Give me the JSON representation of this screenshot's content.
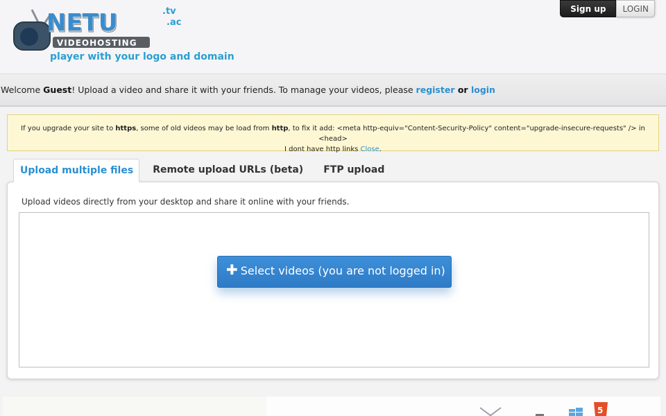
{
  "header": {
    "logo_text": "NETU",
    "logo_sub": "VIDEOHOSTING",
    "domain_tv": ".tv",
    "domain_ac": ".ac",
    "tagline": "player with your logo and domain",
    "signup_label": "Sign up",
    "login_label": "LOGIN"
  },
  "welcome": {
    "prefix": "Welcome ",
    "user": "Guest",
    "text": "! Upload a video and share it with your friends. To manage your videos, please ",
    "register_label": "register",
    "or": " or ",
    "login_label": "login"
  },
  "notice": {
    "p1": "If you upgrade your site to ",
    "https": "https",
    "p2": ", some of old videos may be load from ",
    "http": "http",
    "p3": ", to fix it add: <meta http-equiv=\"Content-Security-Policy\" content=\"upgrade-insecure-requests\" /> in <head>",
    "line2": "I dont have http links ",
    "close_label": "Close",
    "close_suffix": "."
  },
  "tabs": [
    {
      "label": "Upload multiple files",
      "active": true
    },
    {
      "label": "Remote upload URLs (beta)",
      "active": false
    },
    {
      "label": "FTP upload",
      "active": false
    }
  ],
  "upload": {
    "intro": "Upload videos directly from your desktop and share it online with your friends.",
    "select_label": "Select videos (you are not logged in)"
  },
  "colors": {
    "accent": "#2a9fd0",
    "button_blue": "#3388d0",
    "notice_bg": "#fdf7d4"
  }
}
